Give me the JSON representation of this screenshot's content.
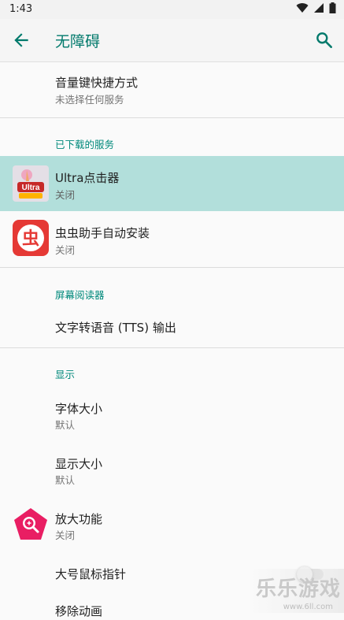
{
  "status": {
    "time": "1:43"
  },
  "app_bar": {
    "title": "无障碍"
  },
  "shortcut": {
    "title": "音量键快捷方式",
    "subtitle": "未选择任何服务"
  },
  "downloaded": {
    "header": "已下载的服务",
    "items": [
      {
        "title": "Ultra点击器",
        "subtitle": "关闭",
        "icon_text": "Ultra"
      },
      {
        "title": "虫虫助手自动安装",
        "subtitle": "关闭",
        "icon_text": "虫"
      }
    ]
  },
  "screen_reader": {
    "header": "屏幕阅读器",
    "tts": "文字转语音 (TTS) 输出"
  },
  "display": {
    "header": "显示",
    "font_size": {
      "title": "字体大小",
      "subtitle": "默认"
    },
    "display_size": {
      "title": "显示大小",
      "subtitle": "默认"
    },
    "magnify": {
      "title": "放大功能",
      "subtitle": "关闭"
    },
    "large_pointer": {
      "title": "大号鼠标指针"
    },
    "remove_anim": {
      "title": "移除动画"
    }
  },
  "watermark": {
    "text": "乐乐游戏",
    "url": "www.6ll.com"
  },
  "colors": {
    "accent": "#00897b",
    "selected": "#b2dfdb",
    "title": "#00796b"
  }
}
